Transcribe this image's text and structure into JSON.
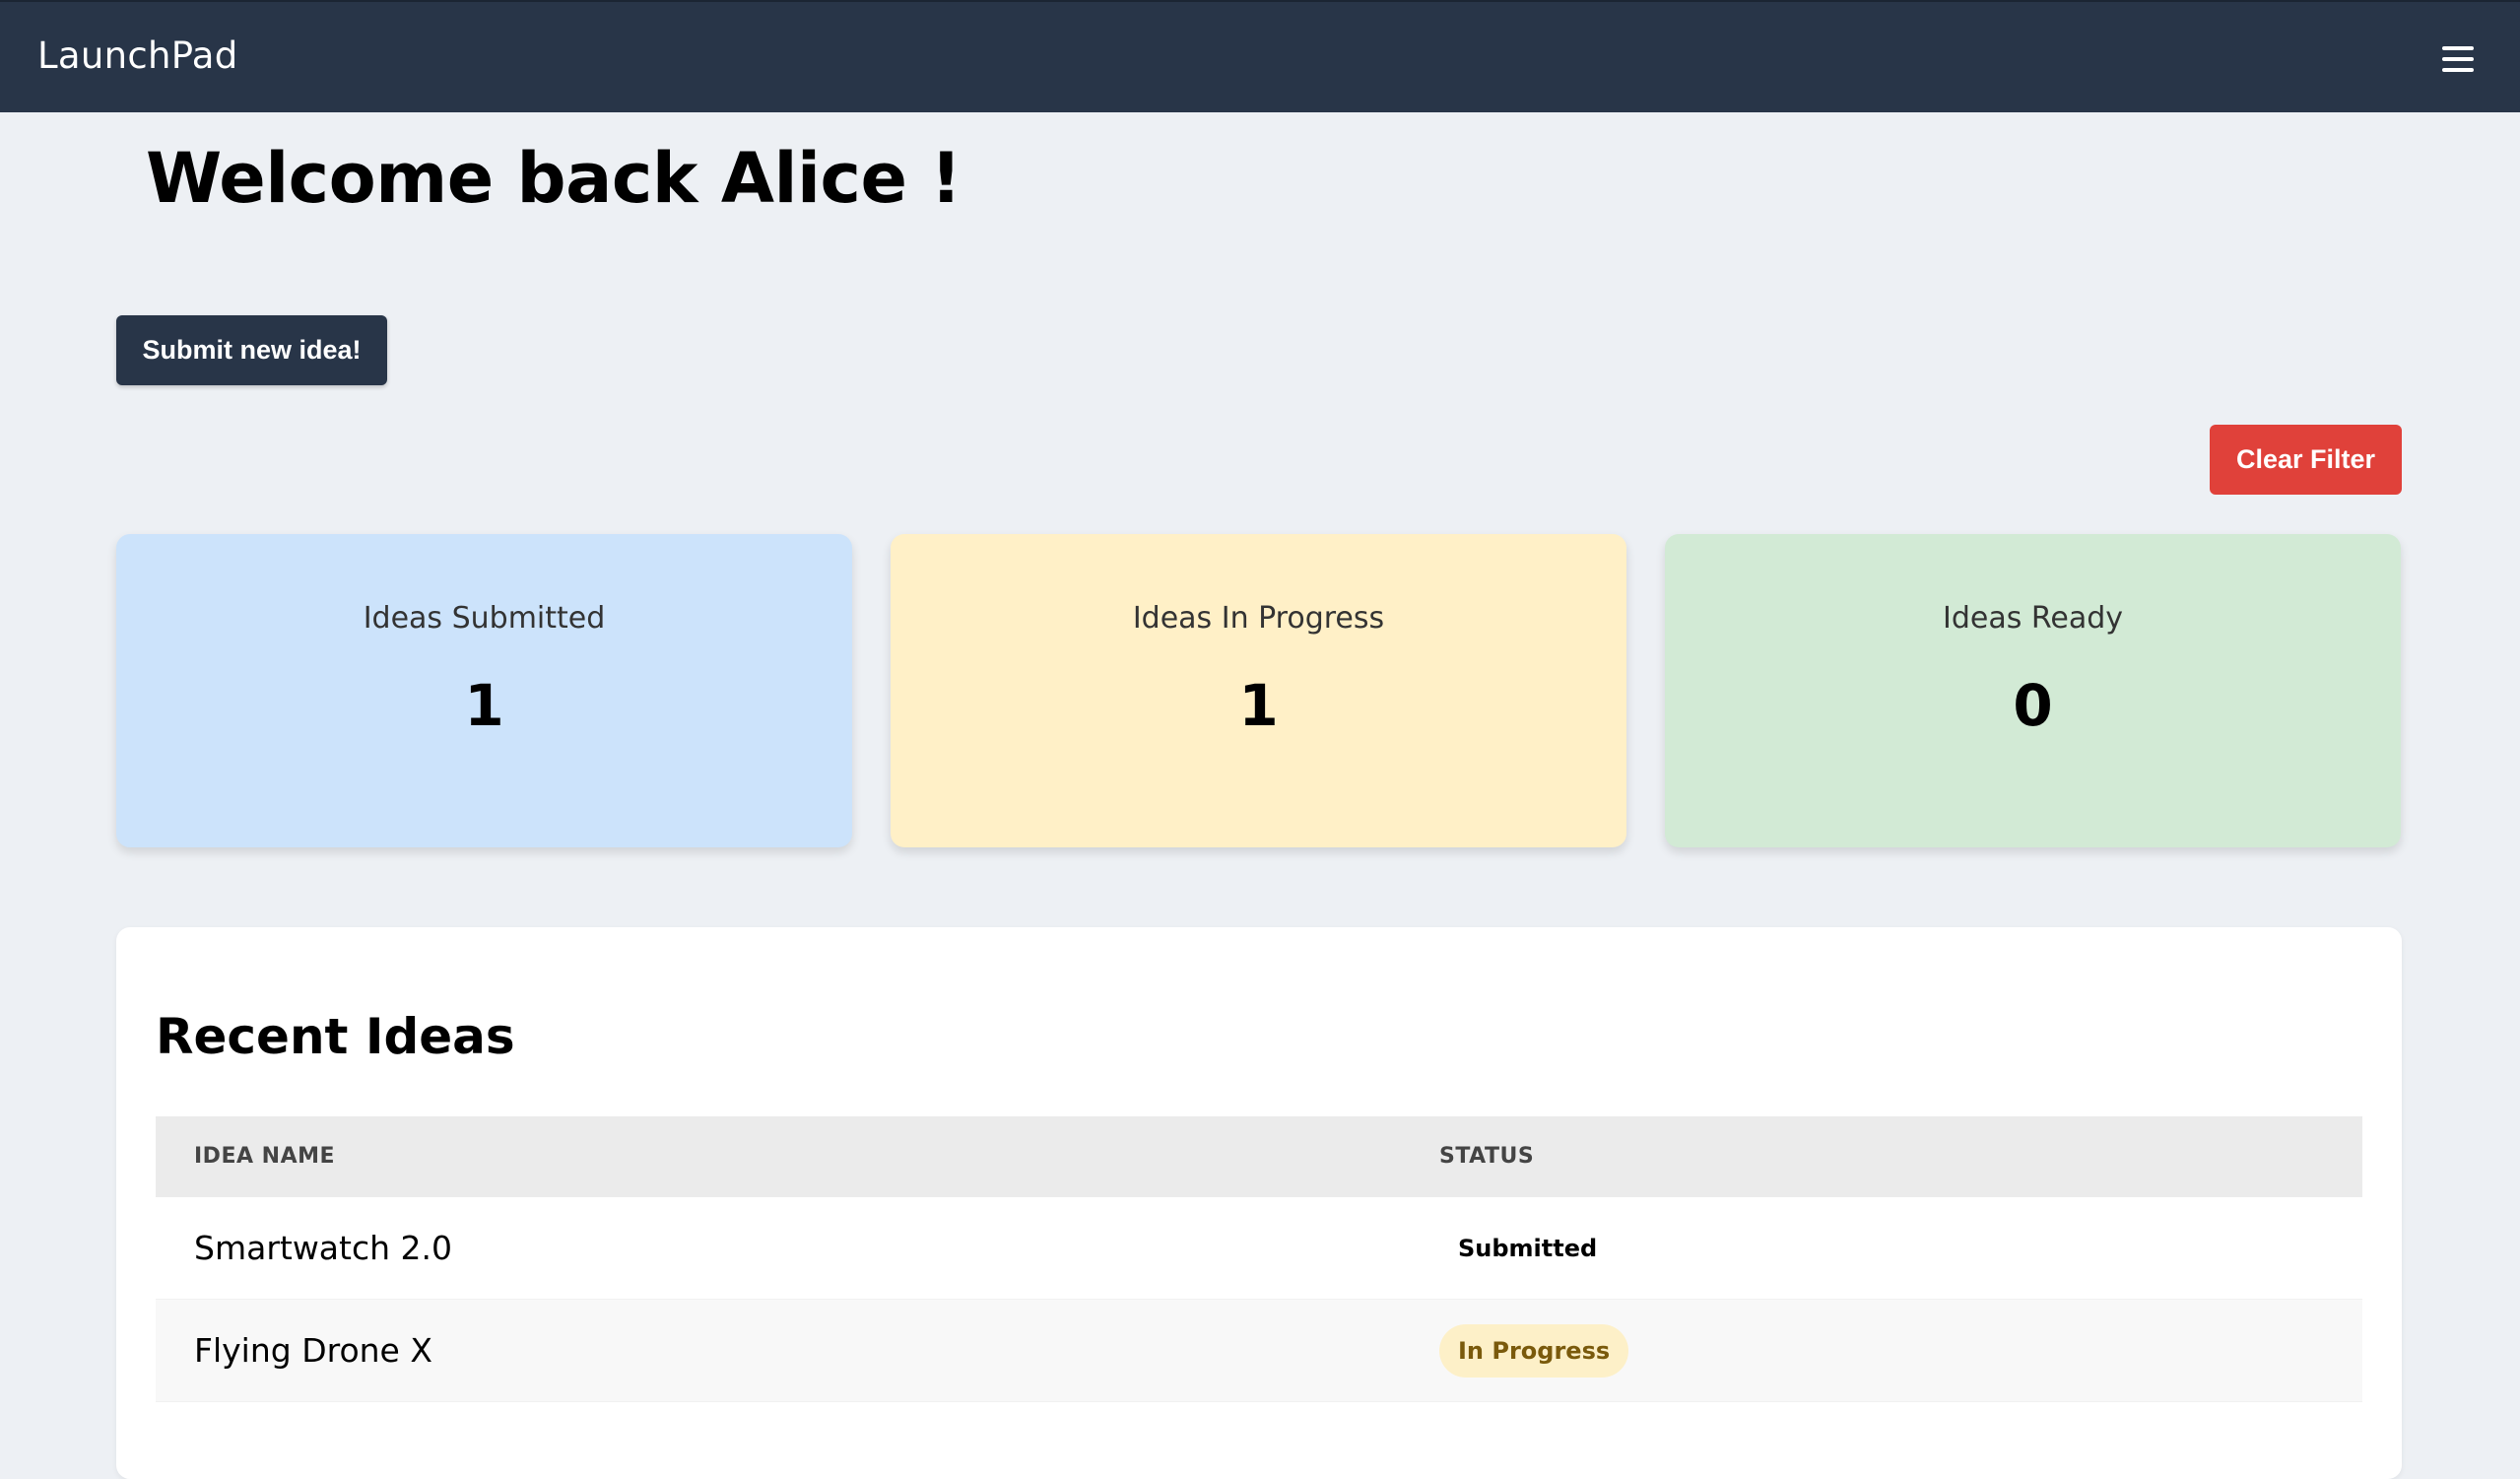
{
  "navbar": {
    "brand": "LaunchPad",
    "menu_icon": "hamburger-menu-icon"
  },
  "header": {
    "welcome_text": "Welcome back Alice !"
  },
  "actions": {
    "submit_label": "Submit new idea!",
    "clear_filter_label": "Clear Filter"
  },
  "stats": [
    {
      "label": "Ideas Submitted",
      "value": "1",
      "color": "#cce3fb"
    },
    {
      "label": "Ideas In Progress",
      "value": "1",
      "color": "#fff0c7"
    },
    {
      "label": "Ideas Ready",
      "value": "0",
      "color": "#d2ead5"
    }
  ],
  "recent": {
    "title": "Recent Ideas",
    "columns": [
      "IDEA NAME",
      "STATUS"
    ],
    "rows": [
      {
        "name": "Smartwatch 2.0",
        "status": "Submitted"
      },
      {
        "name": "Flying Drone X",
        "status": "In Progress",
        "status_color": "#fdf0c8"
      }
    ]
  },
  "colors": {
    "navbar": "#283548",
    "background": "#edf0f4",
    "primary_button": "#283548",
    "danger_button": "#e0413a"
  }
}
